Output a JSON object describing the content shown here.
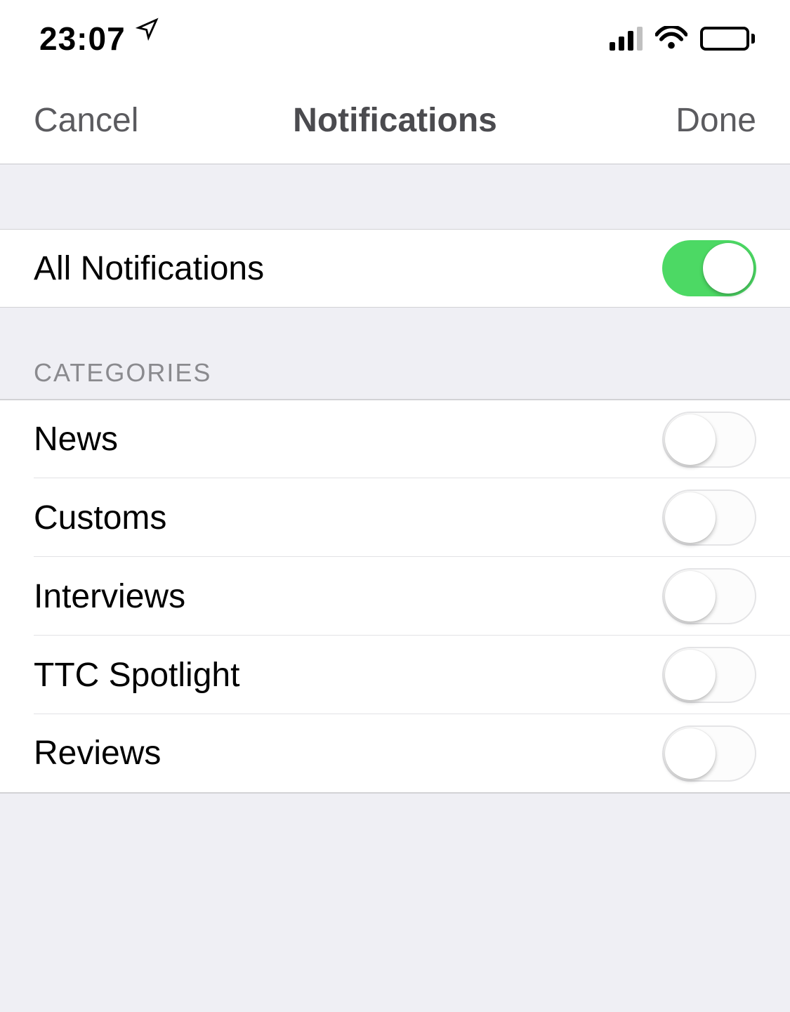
{
  "status": {
    "time": "23:07"
  },
  "nav": {
    "cancel": "Cancel",
    "title": "Notifications",
    "done": "Done"
  },
  "main_toggle": {
    "label": "All Notifications",
    "enabled": true
  },
  "categories_header": "CATEGORIES",
  "categories": [
    {
      "label": "News",
      "enabled": false
    },
    {
      "label": "Customs",
      "enabled": false
    },
    {
      "label": "Interviews",
      "enabled": false
    },
    {
      "label": "TTC Spotlight",
      "enabled": false
    },
    {
      "label": "Reviews",
      "enabled": false
    }
  ]
}
